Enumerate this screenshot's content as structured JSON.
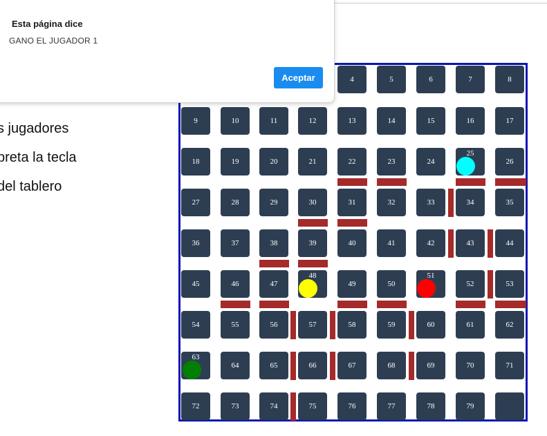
{
  "dialog": {
    "title": "Esta página dice",
    "message": "GANO EL JUGADOR 1",
    "ok_label": "Aceptar"
  },
  "instructions": [
    "s jugadores",
    "preta la tecla",
    "del tablero"
  ],
  "board": {
    "rows": [
      [
        "",
        "",
        "",
        "",
        "4",
        "5",
        "6",
        "7",
        "8"
      ],
      [
        "9",
        "10",
        "11",
        "12",
        "13",
        "14",
        "15",
        "16",
        "17"
      ],
      [
        "18",
        "19",
        "20",
        "21",
        "22",
        "23",
        "24",
        "25",
        "26"
      ],
      [
        "27",
        "28",
        "29",
        "30",
        "31",
        "32",
        "33",
        "34",
        "35"
      ],
      [
        "36",
        "37",
        "38",
        "39",
        "40",
        "41",
        "42",
        "43",
        "44"
      ],
      [
        "45",
        "46",
        "47",
        "48",
        "49",
        "50",
        "51",
        "52",
        "53"
      ],
      [
        "54",
        "55",
        "56",
        "57",
        "58",
        "59",
        "60",
        "61",
        "62"
      ],
      [
        "63",
        "64",
        "65",
        "66",
        "67",
        "68",
        "69",
        "70",
        "71"
      ],
      [
        "72",
        "73",
        "74",
        "75",
        "76",
        "77",
        "78",
        "79",
        ""
      ]
    ],
    "tokens": [
      {
        "cell": "25",
        "color": "#00ffff"
      },
      {
        "cell": "48",
        "color": "#ffff00"
      },
      {
        "cell": "51",
        "color": "#ff0000"
      },
      {
        "cell": "63",
        "color": "#008000"
      }
    ],
    "colors": {
      "cell": "#2e3e52",
      "wall": "#a52a2a",
      "border": "#0a14b4",
      "button": "#1a8cf0"
    }
  }
}
